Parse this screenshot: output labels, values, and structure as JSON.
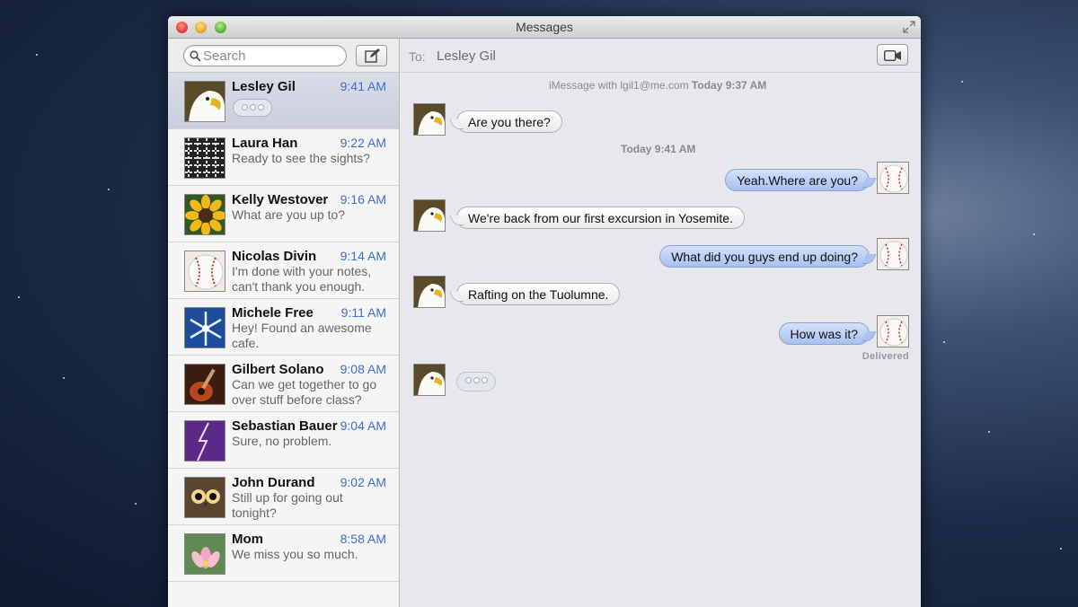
{
  "window": {
    "title": "Messages"
  },
  "sidebar": {
    "search_placeholder": "Search",
    "conversations": [
      {
        "name": "Lesley Gil",
        "time": "9:41 AM",
        "preview": "",
        "typing": true,
        "avatar": "eagle-avatar"
      },
      {
        "name": "Laura Han",
        "time": "9:22 AM",
        "preview": "Ready to see the sights?",
        "avatar": "texture-avatar"
      },
      {
        "name": "Kelly Westover",
        "time": "9:16 AM",
        "preview": "What are you up to?",
        "avatar": "sunflower-avatar"
      },
      {
        "name": "Nicolas Divin",
        "time": "9:14 AM",
        "preview": "I'm done with your notes, can't thank you enough.",
        "avatar": "baseball-avatar"
      },
      {
        "name": "Michele Free",
        "time": "9:11 AM",
        "preview": "Hey! Found an awesome cafe.",
        "avatar": "snowflake-avatar"
      },
      {
        "name": "Gilbert Solano",
        "time": "9:08 AM",
        "preview": "Can we get together to go over stuff before class?",
        "avatar": "guitar-avatar"
      },
      {
        "name": "Sebastian Bauer",
        "time": "9:04 AM",
        "preview": "Sure, no problem.",
        "avatar": "lightning-avatar"
      },
      {
        "name": "John Durand",
        "time": "9:02 AM",
        "preview": "Still up for going out tonight?",
        "avatar": "owl-avatar"
      },
      {
        "name": "Mom",
        "time": "8:58 AM",
        "preview": "We miss you so much.",
        "avatar": "lotus-avatar"
      }
    ]
  },
  "chat": {
    "to_label": "To:",
    "recipient": "Lesley Gil",
    "header_service": "iMessage with lgil1@me.com",
    "header_time": "Today 9:37 AM",
    "timestamp2": "Today 9:41 AM",
    "messages": [
      {
        "from": "them",
        "text": "Are you there?"
      },
      {
        "from": "me",
        "text": "Yeah.Where are you?"
      },
      {
        "from": "them",
        "text": "We're back from our first excursion in Yosemite."
      },
      {
        "from": "me",
        "text": "What did you guys end up doing?"
      },
      {
        "from": "them",
        "text": "Rafting on the Tuolumne."
      },
      {
        "from": "me",
        "text": "How was it?"
      }
    ],
    "delivered": "Delivered"
  },
  "colors": {
    "accent_time": "#3d6fd3",
    "outgoing_bubble": "#a8c0ee",
    "selected_row": "#c9cedc"
  }
}
